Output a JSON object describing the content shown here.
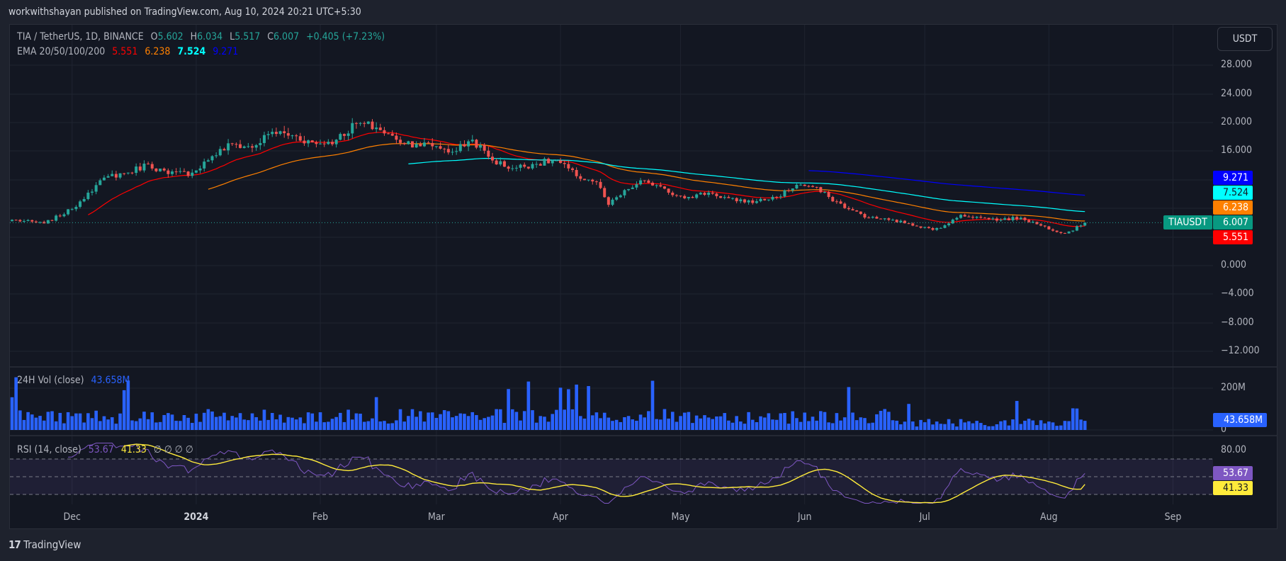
{
  "header": {
    "published": "workwithshayan published on TradingView.com, Aug 10, 2024 20:21 UTC+5:30"
  },
  "legend": {
    "symbol": "TIA / TetherUS, 1D, BINANCE",
    "o_label": "O",
    "o": "5.602",
    "h_label": "H",
    "h": "6.034",
    "l_label": "L",
    "l": "5.517",
    "c_label": "C",
    "c": "6.007",
    "change": "+0.405 (+7.23%)",
    "ema_label": "EMA 20/50/100/200",
    "ema20": "5.551",
    "ema50": "6.238",
    "ema100": "7.524",
    "ema200": "9.271",
    "vol_label": "24H Vol (close)",
    "vol_value": "43.658M",
    "rsi_label": "RSI (14, close)",
    "rsi_value": "53.67",
    "rsi_ma": "41.33",
    "rsi_extra": "∅ ∅ ∅ ∅"
  },
  "unit_button": "USDT",
  "price_axis": [
    "28.000",
    "24.000",
    "20.000",
    "16.000",
    "0.000",
    "−4.000",
    "−8.000",
    "−12.000"
  ],
  "volume_axis": [
    "200M",
    "0"
  ],
  "rsi_axis": [
    "80.00"
  ],
  "badges": {
    "ema200": "9.271",
    "ema100": "7.524",
    "ema50": "6.238",
    "symbol": "TIAUSDT",
    "price": "6.007",
    "ema20": "5.551",
    "volume": "43.658M",
    "rsi": "53.67",
    "rsi_ma": "41.33"
  },
  "time_axis": [
    "Dec",
    "2024",
    "Feb",
    "Mar",
    "Apr",
    "May",
    "Jun",
    "Jul",
    "Aug",
    "Sep"
  ],
  "logo": "TradingView",
  "colors": {
    "up": "#26a69a",
    "down": "#ef5350",
    "ema20": "#ff0000",
    "ema50": "#ff8000",
    "ema100": "#00ffff",
    "ema200": "#0000ff",
    "volume": "#2962ff",
    "rsi": "#7e57c2",
    "rsi_ma": "#ffeb3b"
  },
  "chart_data": {
    "type": "candlestick",
    "title": "TIA / TetherUS, 1D, BINANCE",
    "start_date": "2023-11-16",
    "ylabel": "USDT",
    "ylim": [
      -14,
      32
    ],
    "close_anchors": [
      [
        "2023-11-16",
        6.4
      ],
      [
        "2023-11-24",
        5.9
      ],
      [
        "2023-12-01",
        7.9
      ],
      [
        "2023-12-05",
        10.2
      ],
      [
        "2023-12-10",
        12.5
      ],
      [
        "2023-12-15",
        13.0
      ],
      [
        "2023-12-20",
        14.2
      ],
      [
        "2023-12-25",
        12.8
      ],
      [
        "2023-12-31",
        13.0
      ],
      [
        "2024-01-05",
        15.3
      ],
      [
        "2024-01-10",
        17.0
      ],
      [
        "2024-01-15",
        16.5
      ],
      [
        "2024-01-20",
        18.7
      ],
      [
        "2024-01-25",
        18.2
      ],
      [
        "2024-01-31",
        17.0
      ],
      [
        "2024-02-05",
        17.6
      ],
      [
        "2024-02-10",
        19.9
      ],
      [
        "2024-02-15",
        19.3
      ],
      [
        "2024-02-20",
        17.6
      ],
      [
        "2024-02-25",
        17.0
      ],
      [
        "2024-03-01",
        16.7
      ],
      [
        "2024-03-05",
        15.9
      ],
      [
        "2024-03-10",
        17.6
      ],
      [
        "2024-03-15",
        14.7
      ],
      [
        "2024-03-20",
        13.6
      ],
      [
        "2024-03-25",
        14.2
      ],
      [
        "2024-03-31",
        14.7
      ],
      [
        "2024-04-05",
        12.5
      ],
      [
        "2024-04-10",
        11.7
      ],
      [
        "2024-04-13",
        8.5
      ],
      [
        "2024-04-18",
        10.7
      ],
      [
        "2024-04-22",
        11.9
      ],
      [
        "2024-04-28",
        10.2
      ],
      [
        "2024-05-03",
        9.6
      ],
      [
        "2024-05-08",
        10.2
      ],
      [
        "2024-05-15",
        9.0
      ],
      [
        "2024-05-20",
        9.0
      ],
      [
        "2024-05-25",
        9.6
      ],
      [
        "2024-05-30",
        11.3
      ],
      [
        "2024-06-03",
        11.0
      ],
      [
        "2024-06-07",
        9.6
      ],
      [
        "2024-06-12",
        7.9
      ],
      [
        "2024-06-17",
        6.7
      ],
      [
        "2024-06-22",
        6.4
      ],
      [
        "2024-06-27",
        5.9
      ],
      [
        "2024-07-03",
        5.0
      ],
      [
        "2024-07-07",
        5.9
      ],
      [
        "2024-07-10",
        7.1
      ],
      [
        "2024-07-15",
        6.7
      ],
      [
        "2024-07-20",
        6.4
      ],
      [
        "2024-07-25",
        6.7
      ],
      [
        "2024-07-30",
        5.6
      ],
      [
        "2024-08-05",
        4.5
      ],
      [
        "2024-08-09",
        5.602
      ],
      [
        "2024-08-10",
        6.007
      ]
    ],
    "last_candle": {
      "date": "2024-08-10",
      "open": 5.602,
      "high": 6.034,
      "low": 5.517,
      "close": 6.007
    },
    "ema_periods": [
      20,
      50,
      100,
      200
    ],
    "ema_last": [
      5.551,
      6.238,
      7.524,
      9.271
    ],
    "volume_last": 43.658,
    "volume_unit": "M",
    "volume_ylim": [
      0,
      200
    ],
    "rsi_period": 14,
    "rsi_last": 53.67,
    "rsi_ma_last": 41.33,
    "rsi_bands": [
      30,
      50,
      70
    ]
  }
}
